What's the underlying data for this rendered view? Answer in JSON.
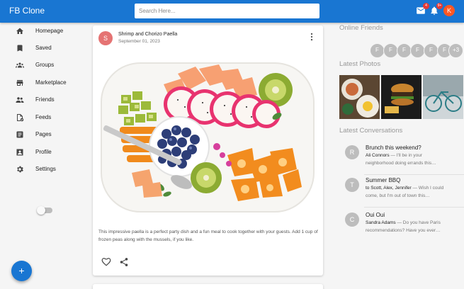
{
  "app": {
    "title": "FB Clone"
  },
  "search": {
    "placeholder": "Search Here..."
  },
  "header": {
    "mail_icon": "mail-icon",
    "mail_badge": "4",
    "notifications_icon": "bell-icon",
    "notifications_badge": "9+",
    "avatar_initial": "K"
  },
  "sidebar": {
    "items": [
      {
        "label": "Homepage",
        "icon": "home-icon"
      },
      {
        "label": "Saved",
        "icon": "bookmark-icon"
      },
      {
        "label": "Groups",
        "icon": "groups-icon"
      },
      {
        "label": "Marketplace",
        "icon": "store-icon"
      },
      {
        "label": "Friends",
        "icon": "people-icon"
      },
      {
        "label": "Feeds",
        "icon": "feed-icon"
      },
      {
        "label": "Pages",
        "icon": "article-icon"
      },
      {
        "label": "Profile",
        "icon": "profile-icon"
      },
      {
        "label": "Settings",
        "icon": "gear-icon"
      }
    ],
    "dark_mode_icon": "moon-icon",
    "dark_mode_on": false
  },
  "fab": {
    "label": "+"
  },
  "post": {
    "avatar_initial": "S",
    "title": "Shrimp and Chorizo Paella",
    "date": "September 01, 2023",
    "body": "This impressive paella is a perfect party dish and a fun meal to cook together with your guests. Add 1 cup of frozen peas along with the mussels, if you like.",
    "like_icon": "heart-outline-icon",
    "share_icon": "share-icon"
  },
  "rightbar": {
    "online_friends_title": "Online Friends",
    "online_friends": [
      "F",
      "F",
      "F",
      "F",
      "F",
      "F"
    ],
    "online_friends_more": "+3",
    "latest_photos_title": "Latest Photos",
    "latest_conversations_title": "Latest Conversations",
    "conversations": [
      {
        "initial": "R",
        "subject": "Brunch this weekend?",
        "sender": "Ali Connors",
        "preview": "— I'll be in your neighborhood doing errands this…"
      },
      {
        "initial": "T",
        "subject": "Summer BBQ",
        "sender": "to Scott, Alex, Jennifer",
        "preview": "— Wish I could come, but I'm out of town this…"
      },
      {
        "initial": "C",
        "subject": "Oui Oui",
        "sender": "Sandra Adams",
        "preview": "— Do you have Paris recommendations? Have you ever…"
      }
    ]
  },
  "colors": {
    "primary": "#1976d2",
    "badge": "#e53935",
    "user_avatar": "#ff5722",
    "post_avatar": "#e57373"
  }
}
